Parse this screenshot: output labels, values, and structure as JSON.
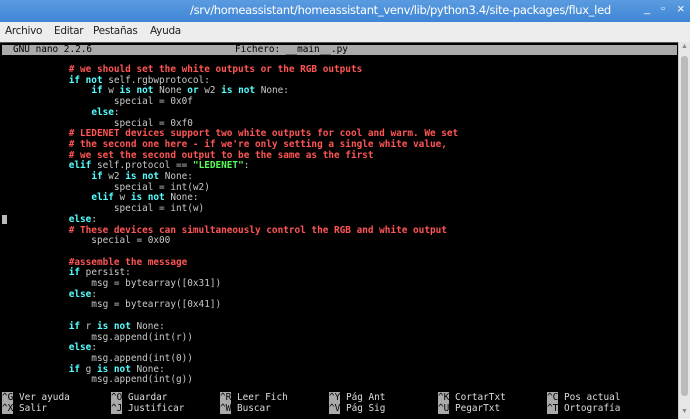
{
  "window": {
    "title": "/srv/homeassistant/homeassistant_venv/lib/python3.4/site-packages/flux_led",
    "minimize": "_",
    "maximize": "▫",
    "close": "×"
  },
  "menu": [
    "Archivo",
    "Editar",
    "Pestañas",
    "Ayuda"
  ],
  "nano": {
    "version": "GNU nano 2.2.6",
    "file": "Fichero: __main__.py"
  },
  "colors": {
    "comment": "#ff5555",
    "keyword": "#55ffff",
    "string": "#55ff55",
    "text": "#c8c8c8",
    "titlebar": "#4a8fdc"
  },
  "code": [
    [
      [
        "c",
        "            # we should set the white outputs or the RGB outputs"
      ]
    ],
    [
      [
        "n",
        "            "
      ],
      [
        "k",
        "if not"
      ],
      [
        "n",
        " self.rgbwprotocol:"
      ]
    ],
    [
      [
        "n",
        "                "
      ],
      [
        "k",
        "if"
      ],
      [
        "n",
        " w "
      ],
      [
        "k",
        "is not"
      ],
      [
        "n",
        " None "
      ],
      [
        "k",
        "or"
      ],
      [
        "n",
        " w2 "
      ],
      [
        "k",
        "is not"
      ],
      [
        "n",
        " None:"
      ]
    ],
    [
      [
        "n",
        "                    special = 0x0f"
      ]
    ],
    [
      [
        "n",
        "                "
      ],
      [
        "k",
        "else"
      ],
      [
        "n",
        ":"
      ]
    ],
    [
      [
        "n",
        "                    special = 0xf0"
      ]
    ],
    [
      [
        "c",
        "            # LEDENET devices support two white outputs for cool and warm. We set"
      ]
    ],
    [
      [
        "c",
        "            # the second one here - if we're only setting a single white value,"
      ]
    ],
    [
      [
        "c",
        "            # we set the second output to be the same as the first"
      ]
    ],
    [
      [
        "n",
        "            "
      ],
      [
        "k",
        "elif"
      ],
      [
        "n",
        " self.protocol == "
      ],
      [
        "s",
        "\"LEDENET\""
      ],
      [
        "n",
        ":"
      ]
    ],
    [
      [
        "n",
        "                "
      ],
      [
        "k",
        "if"
      ],
      [
        "n",
        " w2 "
      ],
      [
        "k",
        "is not"
      ],
      [
        "n",
        " None:"
      ]
    ],
    [
      [
        "n",
        "                    special = int(w2)"
      ]
    ],
    [
      [
        "n",
        "                "
      ],
      [
        "k",
        "elif"
      ],
      [
        "n",
        " w "
      ],
      [
        "k",
        "is not"
      ],
      [
        "n",
        " None:"
      ]
    ],
    [
      [
        "n",
        "                    special = int(w)"
      ]
    ],
    [
      [
        "n",
        "            "
      ],
      [
        "k",
        "else"
      ],
      [
        "n",
        ":"
      ]
    ],
    [
      [
        "c",
        "            # These devices can simultaneously control the RGB and white output"
      ]
    ],
    [
      [
        "n",
        "                special = 0x00"
      ]
    ],
    [],
    [
      [
        "c",
        "            #assemble the message"
      ]
    ],
    [
      [
        "n",
        "            "
      ],
      [
        "k",
        "if"
      ],
      [
        "n",
        " persist:"
      ]
    ],
    [
      [
        "n",
        "                msg = bytearray([0x31])"
      ]
    ],
    [
      [
        "n",
        "            "
      ],
      [
        "k",
        "else"
      ],
      [
        "n",
        ":"
      ]
    ],
    [
      [
        "n",
        "                msg = bytearray([0x41])"
      ]
    ],
    [],
    [
      [
        "n",
        "            "
      ],
      [
        "k",
        "if"
      ],
      [
        "n",
        " r "
      ],
      [
        "k",
        "is not"
      ],
      [
        "n",
        " None:"
      ]
    ],
    [
      [
        "n",
        "                msg.append(int(r))"
      ]
    ],
    [
      [
        "n",
        "            "
      ],
      [
        "k",
        "else"
      ],
      [
        "n",
        ":"
      ]
    ],
    [
      [
        "n",
        "                msg.append(int(0))"
      ]
    ],
    [
      [
        "n",
        "            "
      ],
      [
        "k",
        "if"
      ],
      [
        "n",
        " g "
      ],
      [
        "k",
        "is not"
      ],
      [
        "n",
        " None:"
      ]
    ],
    [
      [
        "n",
        "                msg.append(int(g))"
      ]
    ]
  ],
  "shortcuts": [
    [
      {
        "key": "^G",
        "label": "Ver ayuda"
      },
      {
        "key": "^O",
        "label": "Guardar"
      },
      {
        "key": "^R",
        "label": "Leer Fich"
      },
      {
        "key": "^Y",
        "label": "Pág Ant"
      },
      {
        "key": "^K",
        "label": "CortarTxt"
      },
      {
        "key": "^C",
        "label": "Pos actual"
      }
    ],
    [
      {
        "key": "^X",
        "label": "Salir"
      },
      {
        "key": "^J",
        "label": "Justificar"
      },
      {
        "key": "^W",
        "label": "Buscar"
      },
      {
        "key": "^V",
        "label": "Pág Sig"
      },
      {
        "key": "^U",
        "label": "PegarTxt"
      },
      {
        "key": "^T",
        "label": "Ortografía"
      }
    ]
  ]
}
